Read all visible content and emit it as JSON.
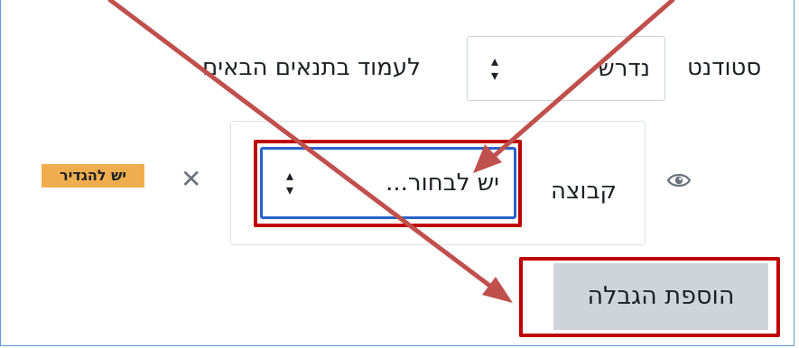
{
  "restriction": {
    "student_label": "סטודנט",
    "requirement_value": "נדרש",
    "condition_text": "לעמוד בתנאים הבאים"
  },
  "group_condition": {
    "type_label": "קבוצה",
    "select_value": "יש לבחור...",
    "status_badge": "יש להגדיר"
  },
  "actions": {
    "add_restriction_label": "הוספת הגבלה"
  },
  "icons": {
    "eye": "eye-icon",
    "delete": "close-icon",
    "select_arrows": "updown-arrows-icon"
  },
  "colors": {
    "annotation_red": "#c00000",
    "arrow_color": "#c0504d",
    "badge_bg": "#f0ad4e",
    "focus_blue": "#2962c8",
    "button_bg": "#ced4da"
  }
}
